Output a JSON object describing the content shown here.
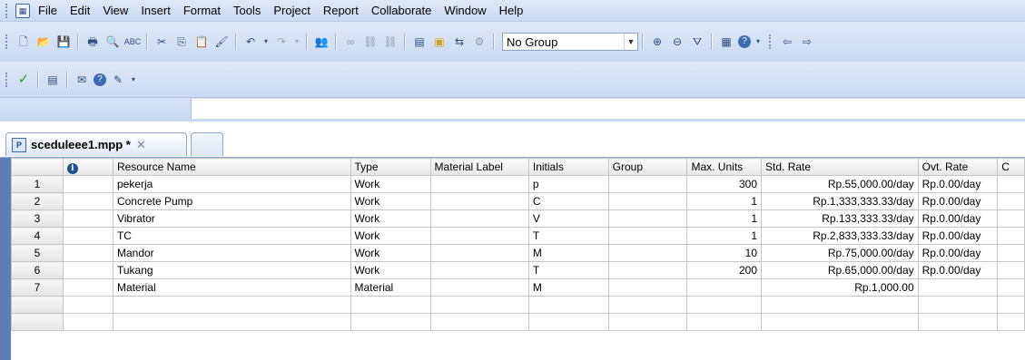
{
  "menu": {
    "items": [
      "File",
      "Edit",
      "View",
      "Insert",
      "Format",
      "Tools",
      "Project",
      "Report",
      "Collaborate",
      "Window",
      "Help"
    ]
  },
  "toolbar": {
    "group_value": "No Group"
  },
  "icons": {
    "new": "new-document-icon",
    "open": "open-folder-icon",
    "save": "save-disk-icon",
    "print": "print-icon",
    "preview": "print-preview-icon",
    "spelling": "spelling-icon",
    "cut": "cut-icon",
    "copy": "copy-icon",
    "paste": "paste-icon",
    "format_painter": "format-painter-icon",
    "undo": "undo-icon",
    "redo": "redo-icon",
    "hyperlink": "hyperlink-icon",
    "check": "checkmark-icon"
  },
  "document": {
    "tab_label": "sceduleee1.mpp *"
  },
  "table": {
    "headers": [
      "",
      "",
      "Resource Name",
      "Type",
      "Material Label",
      "Initials",
      "Group",
      "Max. Units",
      "Std. Rate",
      "Ovt. Rate",
      "C"
    ],
    "rows": [
      {
        "num": "1",
        "name": "pekerja",
        "type": "Work",
        "label": "",
        "initials": "p",
        "group": "",
        "max": "300",
        "std": "Rp.55,000.00/day",
        "ovt": "Rp.0.00/day"
      },
      {
        "num": "2",
        "name": "Concrete Pump",
        "type": "Work",
        "label": "",
        "initials": "C",
        "group": "",
        "max": "1",
        "std": "Rp.1,333,333.33/day",
        "ovt": "Rp.0.00/day"
      },
      {
        "num": "3",
        "name": "Vibrator",
        "type": "Work",
        "label": "",
        "initials": "V",
        "group": "",
        "max": "1",
        "std": "Rp.133,333.33/day",
        "ovt": "Rp.0.00/day"
      },
      {
        "num": "4",
        "name": "TC",
        "type": "Work",
        "label": "",
        "initials": "T",
        "group": "",
        "max": "1",
        "std": "Rp.2,833,333.33/day",
        "ovt": "Rp.0.00/day"
      },
      {
        "num": "5",
        "name": "Mandor",
        "type": "Work",
        "label": "",
        "initials": "M",
        "group": "",
        "max": "10",
        "std": "Rp.75,000.00/day",
        "ovt": "Rp.0.00/day"
      },
      {
        "num": "6",
        "name": "Tukang",
        "type": "Work",
        "label": "",
        "initials": "T",
        "group": "",
        "max": "200",
        "std": "Rp.65,000.00/day",
        "ovt": "Rp.0.00/day"
      },
      {
        "num": "7",
        "name": "Material",
        "type": "Material",
        "label": "",
        "initials": "M",
        "group": "",
        "max": "",
        "std": "Rp.1,000.00",
        "ovt": ""
      }
    ]
  }
}
